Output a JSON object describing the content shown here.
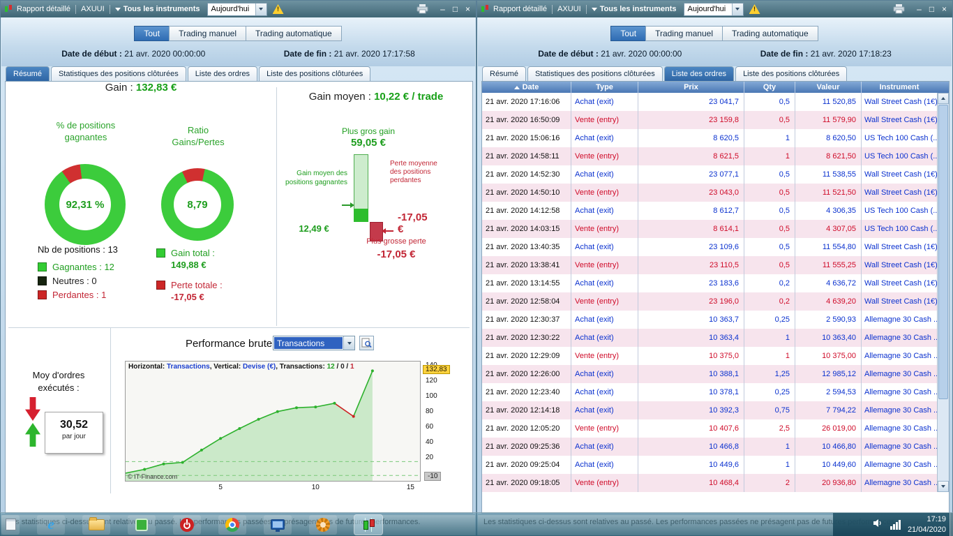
{
  "glyphs": {
    "minimize": "–",
    "maximize": "□",
    "close": "×",
    "warning": "!",
    "ie_letter": "e"
  },
  "colors": {
    "win_green": "#33cc33",
    "loss_red": "#cc2626",
    "buy_blue": "#0a31cf",
    "sell_red": "#cf0a28",
    "selected_blue": "#2f66a5",
    "highlight_yellow": "#ffd23e"
  },
  "left_window": {
    "titlebar": {
      "title": "Rapport détaillé",
      "account": "AXUUI",
      "instruments": "Tous les instruments",
      "period": "Aujourd'hui"
    },
    "mode_buttons": [
      "Tout",
      "Trading manuel",
      "Trading automatique"
    ],
    "dates": {
      "start_label": "Date de début :",
      "start_value": "21 avr. 2020 00:00:00",
      "end_label": "Date de fin :",
      "end_value": "21 avr. 2020 17:17:58"
    },
    "tabs": [
      "Résumé",
      "Statistiques des positions clôturées",
      "Liste des ordres",
      "Liste des positions clôturées"
    ],
    "summary": {
      "gain_label": "Gain :",
      "gain_value": "132,83 €",
      "winrate_title": "% de positions gagnantes",
      "winrate_value": "92,31 %",
      "ratio_title": "Ratio Gains/Pertes",
      "ratio_value": "8,79",
      "nb_positions_label": "Nb de positions : 13",
      "legend": [
        {
          "label": "Gagnantes : 12",
          "color": "#33cc33"
        },
        {
          "label": "Neutres : 0",
          "color": "#16240f"
        },
        {
          "label": "Perdantes : 1",
          "color": "#cc2626"
        }
      ],
      "gain_total_label": "Gain total :",
      "gain_total_value": "149,88 €",
      "loss_total_label": "Perte totale :",
      "loss_total_value": "-17,05 €"
    },
    "avg_panel": {
      "title_label": "Gain moyen :",
      "title_value": "10,22 € / trade",
      "biggest_gain_label": "Plus gros gain",
      "biggest_gain_value": "59,05 €",
      "avg_win_label": "Gain moyen des positions gagnantes",
      "avg_win_value": "12,49 €",
      "avg_loss_label": "Perte moyenne des positions perdantes",
      "avg_loss_value": "-17,05",
      "avg_loss_currency": "€",
      "biggest_loss_label": "Plus grosse perte",
      "biggest_loss_value": "-17,05 €"
    },
    "performance": {
      "title": "Performance brute",
      "dropdown_value": "Transactions",
      "avg_orders_label": "Moy d'ordres exécutés :",
      "avg_orders_value": "30,52",
      "avg_orders_unit": "par jour"
    },
    "status_text": "Les statistiques ci-dessus sont relatives au passé. Les performances passées ne présagent pas de futures performances."
  },
  "right_window": {
    "titlebar": {
      "title": "Rapport détaillé",
      "account": "AXUUI",
      "instruments": "Tous les instruments",
      "period": "Aujourd'hui"
    },
    "mode_buttons": [
      "Tout",
      "Trading manuel",
      "Trading automatique"
    ],
    "dates": {
      "start_label": "Date de début :",
      "start_value": "21 avr. 2020 00:00:00",
      "end_label": "Date de fin :",
      "end_value": "21 avr. 2020 17:18:23"
    },
    "tabs": [
      "Résumé",
      "Statistiques des positions clôturées",
      "Liste des ordres",
      "Liste des positions clôturées"
    ],
    "table": {
      "columns": [
        "Date",
        "Type",
        "Prix",
        "Qty",
        "Valeur",
        "Instrument"
      ],
      "rows": [
        {
          "date": "21 avr. 2020 17:16:06",
          "type": "Achat (exit)",
          "side": "achat",
          "prix": "23 041,7",
          "qty": "0,5",
          "valeur": "11 520,85",
          "instrument": "Wall Street Cash (1€)"
        },
        {
          "date": "21 avr. 2020 16:50:09",
          "type": "Vente (entry)",
          "side": "vente",
          "prix": "23 159,8",
          "qty": "0,5",
          "valeur": "11 579,90",
          "instrument": "Wall Street Cash (1€)"
        },
        {
          "date": "21 avr. 2020 15:06:16",
          "type": "Achat (exit)",
          "side": "achat",
          "prix": "8 620,5",
          "qty": "1",
          "valeur": "8 620,50",
          "instrument": "US Tech 100 Cash (..."
        },
        {
          "date": "21 avr. 2020 14:58:11",
          "type": "Vente (entry)",
          "side": "vente",
          "prix": "8 621,5",
          "qty": "1",
          "valeur": "8 621,50",
          "instrument": "US Tech 100 Cash (..."
        },
        {
          "date": "21 avr. 2020 14:52:30",
          "type": "Achat (exit)",
          "side": "achat",
          "prix": "23 077,1",
          "qty": "0,5",
          "valeur": "11 538,55",
          "instrument": "Wall Street Cash (1€)"
        },
        {
          "date": "21 avr. 2020 14:50:10",
          "type": "Vente (entry)",
          "side": "vente",
          "prix": "23 043,0",
          "qty": "0,5",
          "valeur": "11 521,50",
          "instrument": "Wall Street Cash (1€)"
        },
        {
          "date": "21 avr. 2020 14:12:58",
          "type": "Achat (exit)",
          "side": "achat",
          "prix": "8 612,7",
          "qty": "0,5",
          "valeur": "4 306,35",
          "instrument": "US Tech 100 Cash (..."
        },
        {
          "date": "21 avr. 2020 14:03:15",
          "type": "Vente (entry)",
          "side": "vente",
          "prix": "8 614,1",
          "qty": "0,5",
          "valeur": "4 307,05",
          "instrument": "US Tech 100 Cash (..."
        },
        {
          "date": "21 avr. 2020 13:40:35",
          "type": "Achat (exit)",
          "side": "achat",
          "prix": "23 109,6",
          "qty": "0,5",
          "valeur": "11 554,80",
          "instrument": "Wall Street Cash (1€)"
        },
        {
          "date": "21 avr. 2020 13:38:41",
          "type": "Vente (entry)",
          "side": "vente",
          "prix": "23 110,5",
          "qty": "0,5",
          "valeur": "11 555,25",
          "instrument": "Wall Street Cash (1€)"
        },
        {
          "date": "21 avr. 2020 13:14:55",
          "type": "Achat (exit)",
          "side": "achat",
          "prix": "23 183,6",
          "qty": "0,2",
          "valeur": "4 636,72",
          "instrument": "Wall Street Cash (1€)"
        },
        {
          "date": "21 avr. 2020 12:58:04",
          "type": "Vente (entry)",
          "side": "vente",
          "prix": "23 196,0",
          "qty": "0,2",
          "valeur": "4 639,20",
          "instrument": "Wall Street Cash (1€)"
        },
        {
          "date": "21 avr. 2020 12:30:37",
          "type": "Achat (exit)",
          "side": "achat",
          "prix": "10 363,7",
          "qty": "0,25",
          "valeur": "2 590,93",
          "instrument": "Allemagne 30 Cash ..."
        },
        {
          "date": "21 avr. 2020 12:30:22",
          "type": "Achat (exit)",
          "side": "achat",
          "prix": "10 363,4",
          "qty": "1",
          "valeur": "10 363,40",
          "instrument": "Allemagne 30 Cash ..."
        },
        {
          "date": "21 avr. 2020 12:29:09",
          "type": "Vente (entry)",
          "side": "vente",
          "prix": "10 375,0",
          "qty": "1",
          "valeur": "10 375,00",
          "instrument": "Allemagne 30 Cash ..."
        },
        {
          "date": "21 avr. 2020 12:26:00",
          "type": "Achat (exit)",
          "side": "achat",
          "prix": "10 388,1",
          "qty": "1,25",
          "valeur": "12 985,12",
          "instrument": "Allemagne 30 Cash ..."
        },
        {
          "date": "21 avr. 2020 12:23:40",
          "type": "Achat (exit)",
          "side": "achat",
          "prix": "10 378,1",
          "qty": "0,25",
          "valeur": "2 594,53",
          "instrument": "Allemagne 30 Cash ..."
        },
        {
          "date": "21 avr. 2020 12:14:18",
          "type": "Achat (exit)",
          "side": "achat",
          "prix": "10 392,3",
          "qty": "0,75",
          "valeur": "7 794,22",
          "instrument": "Allemagne 30 Cash ..."
        },
        {
          "date": "21 avr. 2020 12:05:20",
          "type": "Vente (entry)",
          "side": "vente",
          "prix": "10 407,6",
          "qty": "2,5",
          "valeur": "26 019,00",
          "instrument": "Allemagne 30 Cash ..."
        },
        {
          "date": "21 avr. 2020 09:25:36",
          "type": "Achat (exit)",
          "side": "achat",
          "prix": "10 466,8",
          "qty": "1",
          "valeur": "10 466,80",
          "instrument": "Allemagne 30 Cash ..."
        },
        {
          "date": "21 avr. 2020 09:25:04",
          "type": "Achat (exit)",
          "side": "achat",
          "prix": "10 449,6",
          "qty": "1",
          "valeur": "10 449,60",
          "instrument": "Allemagne 30 Cash ..."
        },
        {
          "date": "21 avr. 2020 09:18:05",
          "type": "Vente (entry)",
          "side": "vente",
          "prix": "10 468,4",
          "qty": "2",
          "valeur": "20 936,80",
          "instrument": "Allemagne 30 Cash ..."
        }
      ]
    },
    "status_text": "Les statistiques ci-dessus sont relatives au passé. Les performances passées ne présagent pas de futures performances."
  },
  "taskbar": {
    "time": "17:19",
    "date": "21/04/2020",
    "icons": [
      "app-window-icon",
      "internet-explorer-icon",
      "folder-icon",
      "green-app-icon",
      "power-icon",
      "chrome-icon",
      "display-icon",
      "settings-gear-icon",
      "prorealtime-candlestick-icon",
      "volume-icon",
      "network-signal-icon"
    ]
  },
  "chart_data": {
    "type": "line",
    "title": "Performance brute",
    "series_name": "Transactions",
    "points": [
      [
        0,
        0
      ],
      [
        1,
        5
      ],
      [
        2,
        12
      ],
      [
        3,
        14
      ],
      [
        4,
        30
      ],
      [
        5,
        45
      ],
      [
        6,
        58
      ],
      [
        7,
        70
      ],
      [
        8,
        80
      ],
      [
        9,
        85
      ],
      [
        10,
        86
      ],
      [
        11,
        90.83
      ],
      [
        12,
        73.78
      ],
      [
        13,
        132.83
      ]
    ],
    "loss_segment_start_index": 11,
    "xlim": [
      0,
      15.5
    ],
    "ylim": [
      -10,
      145
    ],
    "xticks": [
      5,
      10,
      15
    ],
    "yticks": [
      140,
      120,
      100,
      80,
      60,
      40,
      20
    ],
    "final_value_num": 132.83,
    "final_value_label": "132,83",
    "min_value_num": -10,
    "min_value_label": "-10",
    "dashed_levels": [
      15,
      -3
    ],
    "line_color": "#2db12d",
    "loss_color": "#cc2222",
    "area_color": "rgba(120,205,120,0.35)",
    "copyright": "© IT-Finance.com",
    "legend": {
      "h_label": "Horizontal:",
      "h_value": "Transactions",
      "v_label": "Vertical:",
      "v_value": "Devise (€)",
      "t_label": "Transactions:",
      "sep": ", ",
      "slash": " / "
    },
    "counts": {
      "wins": "12",
      "neutral": "0",
      "losses": "1"
    }
  }
}
